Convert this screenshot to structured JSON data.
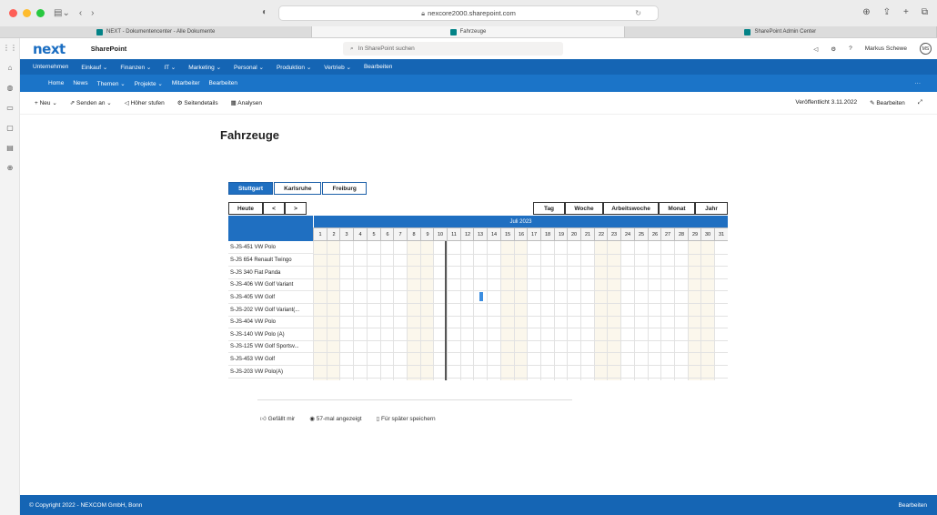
{
  "browser": {
    "url": "nexcore2000.sharepoint.com",
    "tabs": [
      {
        "label": "NEXT - Dokumentencenter - Alle Dokumente",
        "active": false
      },
      {
        "label": "Fahrzeuge",
        "active": true
      },
      {
        "label": "SharePoint Admin Center",
        "active": false
      }
    ]
  },
  "suite": {
    "logo": "next",
    "app_name": "SharePoint",
    "search_placeholder": "In SharePoint suchen",
    "user_name": "Markus Schewe",
    "user_initials": "MS",
    "help": "?"
  },
  "nav1": {
    "items": [
      "Unternehmen",
      "Einkauf ⌄",
      "Finanzen ⌄",
      "IT ⌄",
      "Marketing ⌄",
      "Personal ⌄",
      "Produktion ⌄",
      "Vertrieb ⌄",
      "Bearbeiten"
    ]
  },
  "nav2": {
    "items": [
      "Home",
      "News",
      "Themen ⌄",
      "Projekte ⌄",
      "Mitarbeiter",
      "Bearbeiten"
    ],
    "more": "···"
  },
  "cmdbar": {
    "items": [
      "+ Neu ⌄",
      "Senden an ⌄",
      "Höher stufen",
      "Seitendetails",
      "Analysen"
    ],
    "published": "Veröffentlicht 3.11.2022",
    "edit": "Bearbeiten"
  },
  "page": {
    "title": "Fahrzeuge",
    "locations": [
      {
        "label": "Stuttgart",
        "active": true
      },
      {
        "label": "Karlsruhe",
        "active": false
      },
      {
        "label": "Freiburg",
        "active": false
      }
    ],
    "nav_controls": [
      "Heute",
      "<",
      ">"
    ],
    "views": [
      "Tag",
      "Woche",
      "Arbeitswoche",
      "Monat",
      "Jahr"
    ],
    "month": "Juli 2023",
    "days": [
      "1",
      "2",
      "3",
      "4",
      "5",
      "6",
      "7",
      "8",
      "9",
      "10",
      "11",
      "12",
      "13",
      "14",
      "15",
      "16",
      "17",
      "18",
      "19",
      "20",
      "21",
      "22",
      "23",
      "24",
      "25",
      "26",
      "27",
      "28",
      "29",
      "30",
      "31"
    ],
    "weekend_days": [
      1,
      2,
      8,
      9,
      15,
      16,
      22,
      23,
      29,
      30
    ],
    "today_day": 10,
    "vehicles": [
      "S-JS-451 VW Polo",
      "S-JS 654 Renault Twingo",
      "S-JS 340 Fiat Panda",
      "S-JS-406 VW Golf Variant",
      "S-JS-405 VW Golf",
      "S-JS-202 VW Golf Variant(...",
      "S-JS-404 VW Polo",
      "S-JS-140 VW Polo (A)",
      "S-JS-125 VW Golf Sportsv...",
      "S-JS-453 VW Golf",
      "S-JS-203 VW Polo(A)"
    ],
    "bookings": [
      {
        "vehicle_index": 4,
        "day": 13
      }
    ]
  },
  "social": {
    "like": "Gefällt mir",
    "views": "57-mal angezeigt",
    "save": "Für später speichern"
  },
  "footer": {
    "copyright": "© Copyright 2022 - NEXCOM GmbH, Bonn",
    "edit": "Bearbeiten"
  },
  "colors": {
    "brand": "#1565b4",
    "accent": "#1f6fc1"
  }
}
